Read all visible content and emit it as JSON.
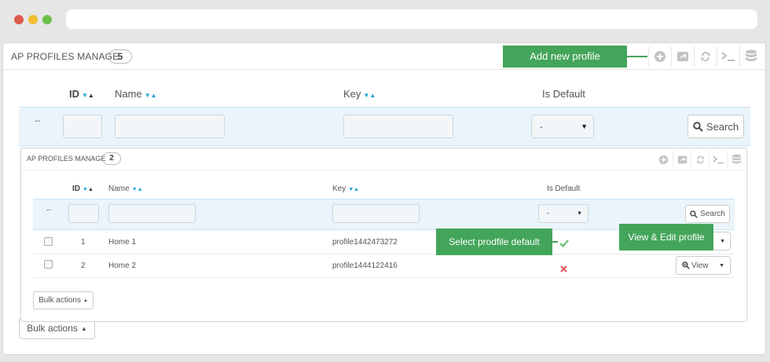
{
  "browser": {
    "dots": [
      "close",
      "minimize",
      "maximize"
    ]
  },
  "outer_panel": {
    "title": "AP PROFILES MANAGE",
    "count": "5",
    "toolbar": [
      "add-icon",
      "export-icon",
      "refresh-icon",
      "sql-query-icon",
      "database-icon"
    ],
    "headers": {
      "id": "ID",
      "name": "Name",
      "key": "Key",
      "is_default": "Is Default"
    },
    "filter": {
      "dashes": "--",
      "select_value": "-",
      "search_label": "Search"
    },
    "bulk_actions": "Bulk actions"
  },
  "inner_panel": {
    "title": "AP PROFILES MANAGE",
    "count": "2",
    "toolbar": [
      "add-icon",
      "export-icon",
      "refresh-icon",
      "sql-query-icon",
      "database-icon"
    ],
    "headers": {
      "id": "ID",
      "name": "Name",
      "key": "Key",
      "is_default": "Is Default"
    },
    "filter": {
      "dashes": "--",
      "select_value": "-",
      "search_label": "Search"
    },
    "rows": [
      {
        "id": "1",
        "name": "Home 1",
        "key": "profile1442473272",
        "is_default": true
      },
      {
        "id": "2",
        "name": "Home 2",
        "key": "profile1444122416",
        "is_default": false
      }
    ],
    "view_label": "View",
    "bulk_actions": "Bulk actions"
  },
  "callouts": {
    "add_new": "Add new profile",
    "select_default": "Select prodfile default",
    "view_edit": "View & Edit profile"
  },
  "colors": {
    "accent_green": "#43a55a",
    "filter_blue": "#eaf4fa",
    "sort_blue": "#1ba1d8",
    "check_green": "#72c279",
    "cross_red": "#e05b5b"
  }
}
